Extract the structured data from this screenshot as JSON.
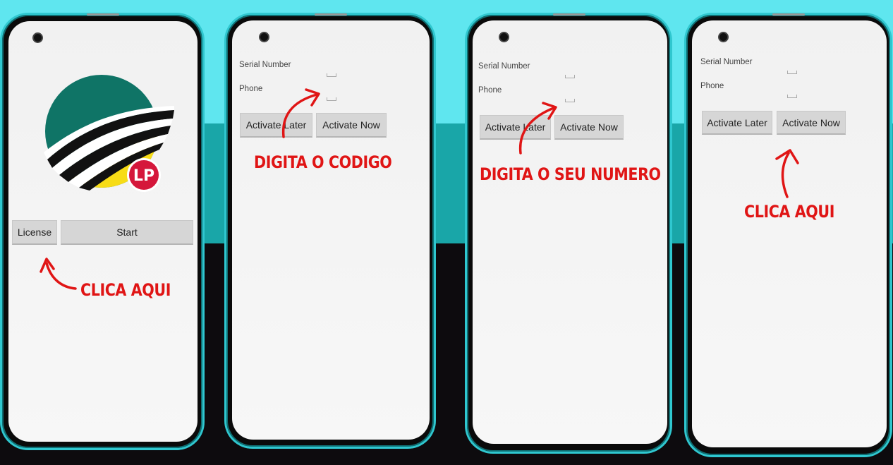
{
  "screens": [
    {
      "logo_text": "LP",
      "license_label": "License",
      "start_label": "Start",
      "callout": "CLICA AQUI"
    },
    {
      "serial_label": "Serial Number",
      "phone_label": "Phone",
      "later_label": "Activate Later",
      "now_label": "Activate Now",
      "callout": "DIGITA O CODIGO"
    },
    {
      "serial_label": "Serial Number",
      "phone_label": "Phone",
      "later_label": "Activate Later",
      "now_label": "Activate Now",
      "callout": "DIGITA O SEU NUMERO"
    },
    {
      "serial_label": "Serial Number",
      "phone_label": "Phone",
      "later_label": "Activate Later",
      "now_label": "Activate Now",
      "callout": "CLICA AQUI"
    }
  ],
  "colors": {
    "callout": "#e01515",
    "bg_top": "#5fe6ef",
    "bg_mid": "#19a6a8",
    "bg_bottom": "#0d0b0e",
    "logo_green": "#0f7466",
    "logo_yellow": "#f7dc16",
    "logo_badge": "#d5173b"
  }
}
